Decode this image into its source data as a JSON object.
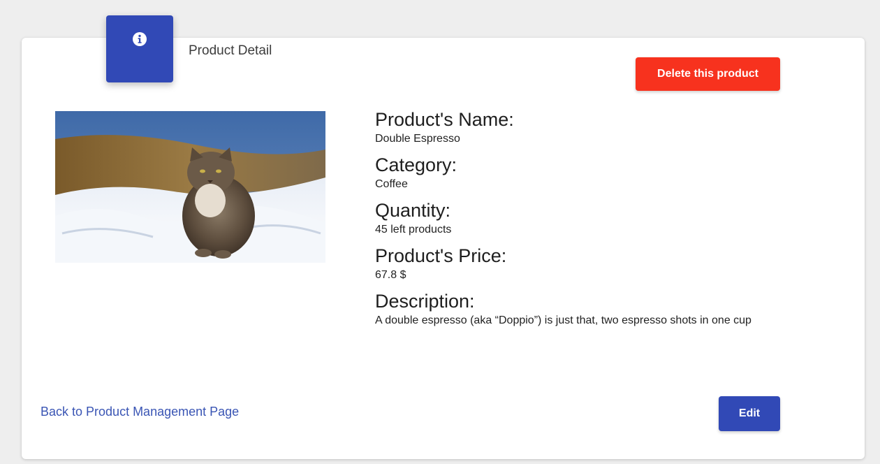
{
  "header": {
    "title": "Product Detail",
    "icon": "info-icon"
  },
  "actions": {
    "delete_label": "Delete this product",
    "edit_label": "Edit",
    "back_link_label": "Back to Product Management Page"
  },
  "product": {
    "image_subject": "cat sitting in snow",
    "fields": [
      {
        "label": "Product's Name:",
        "value": "Double Espresso"
      },
      {
        "label": "Category:",
        "value": "Coffee"
      },
      {
        "label": "Quantity:",
        "value": "45 left products"
      },
      {
        "label": "Product's Price:",
        "value": "67.8 $"
      },
      {
        "label": "Description:",
        "value": "A double espresso (aka “Doppio”) is just that, two espresso shots in one cup"
      }
    ]
  },
  "colors": {
    "primary": "#3149b6",
    "danger": "#f7321e",
    "link": "#3a55b4"
  }
}
